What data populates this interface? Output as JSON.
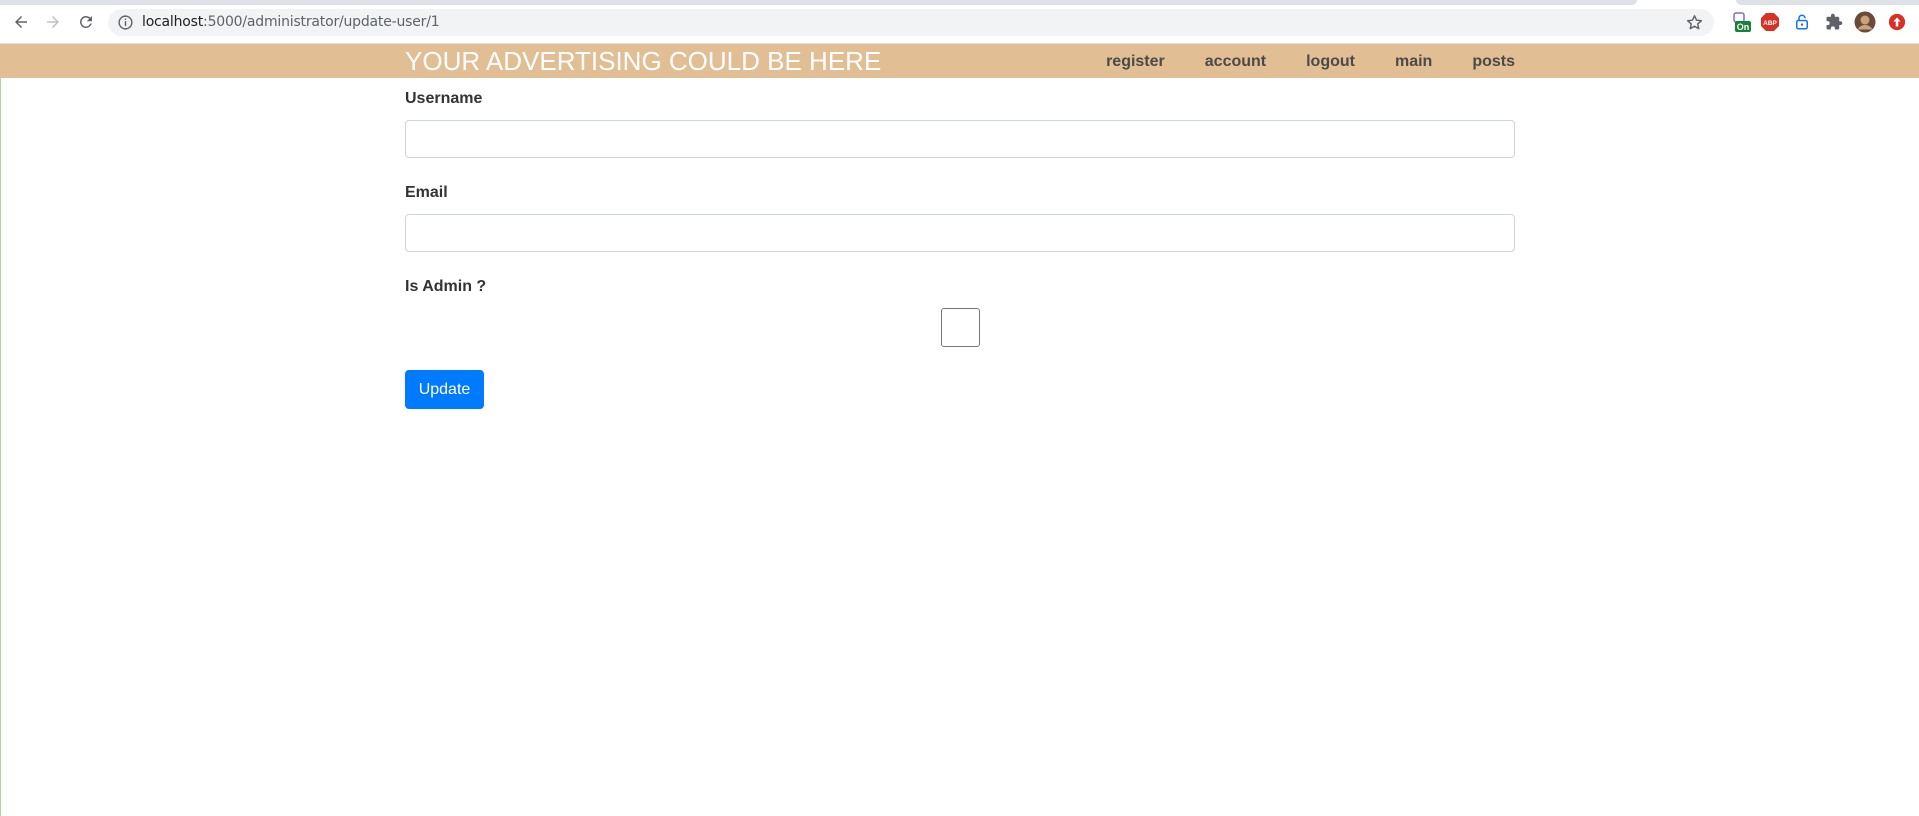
{
  "browser": {
    "url_host": "localhost",
    "url_path": ":5000/administrator/update-user/1",
    "extension_badge": "On",
    "extension_abp": "ABP"
  },
  "site": {
    "brand": "YOUR ADVERTISING COULD BE HERE",
    "nav": [
      "register",
      "account",
      "logout",
      "main",
      "posts"
    ]
  },
  "form": {
    "username_label": "Username",
    "username_value": "",
    "email_label": "Email",
    "email_value": "",
    "is_admin_label": "Is Admin ?",
    "is_admin_checked": false,
    "submit_label": "Update"
  },
  "colors": {
    "header_bg": "#e2be94",
    "primary_button": "#007bff"
  }
}
